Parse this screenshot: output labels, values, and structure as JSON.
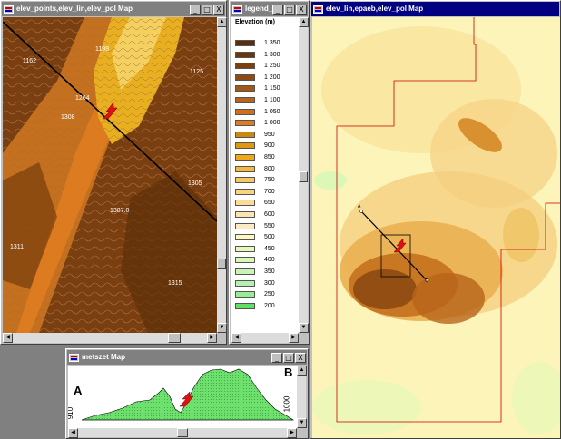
{
  "windows": {
    "points_map": {
      "title": "elev_points,elev_lin,elev_pol Map"
    },
    "legend": {
      "title": "legend_ele..."
    },
    "main_map": {
      "title": "elev_lin,epaeb,elev_pol Map"
    },
    "profile": {
      "title": "metszet Map"
    }
  },
  "title_buttons": {
    "minimize": "_",
    "maximize": "□",
    "close": "X"
  },
  "points_map": {
    "spot_labels": [
      {
        "text": "1198"
      },
      {
        "text": "1162"
      },
      {
        "text": "1125"
      },
      {
        "text": "1264"
      },
      {
        "text": "1308"
      },
      {
        "text": "1305"
      },
      {
        "text": "1387.0"
      },
      {
        "text": "1311"
      },
      {
        "text": "1315"
      }
    ]
  },
  "legend": {
    "heading": "Elevation (m)",
    "items": [
      {
        "value": "1 350",
        "color": "#5a2e0a"
      },
      {
        "value": "1 300",
        "color": "#6b360b"
      },
      {
        "value": "1 250",
        "color": "#7c400e"
      },
      {
        "value": "1 200",
        "color": "#8d4a12"
      },
      {
        "value": "1 150",
        "color": "#a45816"
      },
      {
        "value": "1 100",
        "color": "#b8641a"
      },
      {
        "value": "1 050",
        "color": "#cc701e"
      },
      {
        "value": "1 000",
        "color": "#e07c20"
      },
      {
        "value": "950",
        "color": "#c88a10"
      },
      {
        "value": "900",
        "color": "#e09810"
      },
      {
        "value": "850",
        "color": "#f0a818"
      },
      {
        "value": "800",
        "color": "#f4b83c"
      },
      {
        "value": "750",
        "color": "#f6c860"
      },
      {
        "value": "700",
        "color": "#f8d480"
      },
      {
        "value": "650",
        "color": "#fadc98"
      },
      {
        "value": "600",
        "color": "#fce4b0"
      },
      {
        "value": "550",
        "color": "#fcecc4"
      },
      {
        "value": "500",
        "color": "#fcf8c0"
      },
      {
        "value": "450",
        "color": "#e8f8b8"
      },
      {
        "value": "400",
        "color": "#d8f8b8"
      },
      {
        "value": "350",
        "color": "#c8f4b8"
      },
      {
        "value": "300",
        "color": "#b4f0b0"
      },
      {
        "value": "250",
        "color": "#98ec98"
      },
      {
        "value": "200",
        "color": "#60e060"
      }
    ]
  },
  "main_map": {
    "point_a": "A",
    "point_b": "B"
  },
  "profile": {
    "label_a": "A",
    "label_b": "B",
    "left_value": "910",
    "right_value": "1000"
  },
  "colors": {
    "active_title": "#000080",
    "inactive_title": "#808080",
    "outline": "#cc0000",
    "profile_fill": "#6ee06e"
  }
}
